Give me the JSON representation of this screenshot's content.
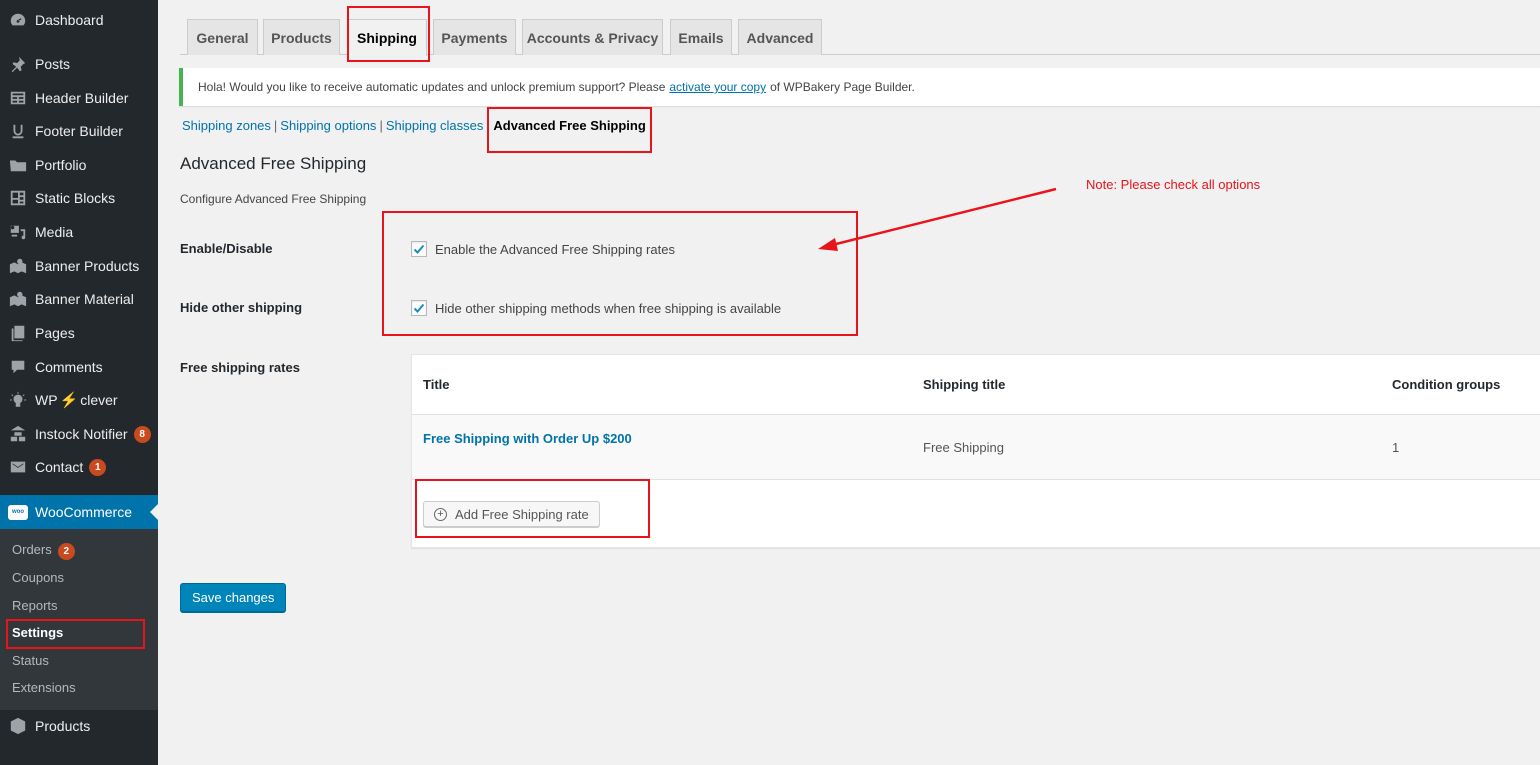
{
  "sidebar": {
    "items": [
      {
        "label": "Dashboard",
        "icon": "dashboard-icon"
      },
      {
        "label": "Posts",
        "icon": "pin-icon"
      },
      {
        "label": "Header Builder",
        "icon": "table-icon"
      },
      {
        "label": "Footer Builder",
        "icon": "underline-icon"
      },
      {
        "label": "Portfolio",
        "icon": "folder-icon"
      },
      {
        "label": "Static Blocks",
        "icon": "blocks-icon"
      },
      {
        "label": "Media",
        "icon": "media-icon"
      },
      {
        "label": "Banner Products",
        "icon": "map-pin-icon"
      },
      {
        "label": "Banner Material",
        "icon": "map-pin-icon"
      },
      {
        "label": "Pages",
        "icon": "pages-icon"
      },
      {
        "label": "Comments",
        "icon": "comment-icon"
      },
      {
        "label_prefix": "WP",
        "label_suffix": "clever",
        "icon": "lightbulb-icon"
      },
      {
        "label": "Instock Notifier",
        "icon": "boxes-icon",
        "badge": "8"
      },
      {
        "label": "Contact",
        "icon": "envelope-icon",
        "badge": "1"
      },
      {
        "label": "WooCommerce",
        "icon": "woo-icon",
        "logo_text": "woo"
      },
      {
        "label": "Products",
        "icon": "box-icon"
      }
    ],
    "submenu": [
      {
        "label": "Orders",
        "badge": "2"
      },
      {
        "label": "Coupons"
      },
      {
        "label": "Reports"
      },
      {
        "label": "Settings"
      },
      {
        "label": "Status"
      },
      {
        "label": "Extensions"
      }
    ]
  },
  "tabs": [
    "General",
    "Products",
    "Shipping",
    "Payments",
    "Accounts & Privacy",
    "Emails",
    "Advanced"
  ],
  "notice": {
    "before": "Hola! Would you like to receive automatic updates and unlock premium support? Please",
    "link": "activate your copy",
    "after": "of WPBakery Page Builder."
  },
  "subnav": {
    "links": [
      "Shipping zones",
      "Shipping options",
      "Shipping classes"
    ],
    "current": "Advanced Free Shipping",
    "separator": "|"
  },
  "section": {
    "title": "Advanced Free Shipping",
    "description": "Configure Advanced Free Shipping"
  },
  "fields": {
    "enable": {
      "label": "Enable/Disable",
      "checkbox_label": "Enable the Advanced Free Shipping rates",
      "checked": true
    },
    "hide": {
      "label": "Hide other shipping",
      "checkbox_label": "Hide other shipping methods when free shipping is available",
      "checked": true
    },
    "rates": {
      "label": "Free shipping rates"
    }
  },
  "rates_table": {
    "headers": [
      "Title",
      "Shipping title",
      "Condition groups"
    ],
    "rows": [
      {
        "title": "Free Shipping with Order Up $200",
        "shipping_title": "Free Shipping",
        "condition_groups": "1"
      }
    ],
    "add_button": "Add Free Shipping rate"
  },
  "save_button": "Save changes",
  "annotation": {
    "note": "Note: Please check all options",
    "color": "#e8141c"
  }
}
